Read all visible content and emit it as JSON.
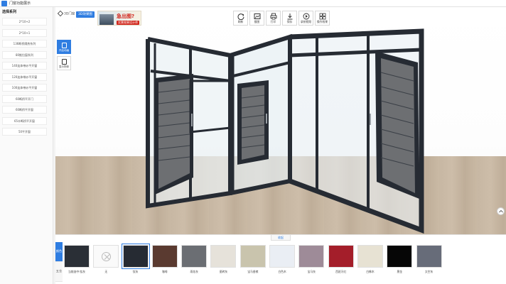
{
  "window": {
    "title": "门窗功能展示"
  },
  "sidebar": {
    "header": "选择系列",
    "items": [
      {
        "label": "2*10+2"
      },
      {
        "label": "2*10+1"
      },
      {
        "label": "136断桥隔热系列"
      },
      {
        "label": "80推拉窗系列"
      },
      {
        "label": "140连体带纱平开窗"
      },
      {
        "label": "120连体带纱平开窗"
      },
      {
        "label": "100连体带纱平开窗"
      },
      {
        "label": "60断桥平开门"
      },
      {
        "label": "60断桥平开窗"
      },
      {
        "label": "65丰断桥平开窗"
      },
      {
        "label": "50平开窗"
      }
    ]
  },
  "viewport": {
    "logo_text": "3D门窗",
    "tag_label": "3D效果图",
    "banner": {
      "title": "急出图?",
      "subtitle": "实景效果设计师"
    },
    "toolbar": [
      {
        "label": "刷新",
        "icon": "refresh-icon"
      },
      {
        "label": "截图",
        "icon": "image-icon"
      },
      {
        "label": "打印",
        "icon": "printer-icon"
      },
      {
        "label": "保存",
        "icon": "download-icon"
      },
      {
        "label": "录制视频",
        "icon": "play-icon"
      },
      {
        "label": "操作效果",
        "icon": "grid-icon"
      }
    ],
    "side_tools": [
      {
        "label": "开启动画",
        "icon": "window-open-icon"
      },
      {
        "label": "显示物体",
        "icon": "cube-icon"
      }
    ]
  },
  "bottom_panel": {
    "handle_label": "收起",
    "tabs": [
      {
        "label": "颜色"
      },
      {
        "label": "五金"
      }
    ],
    "selected_swatch": 2,
    "swatches": [
      {
        "label": "当前选中:钛灰",
        "color": "#2a2f36"
      },
      {
        "label": "无",
        "color": "none"
      },
      {
        "label": "钛灰",
        "color": "#262b33"
      },
      {
        "label": "咖啡",
        "color": "#5a3a30"
      },
      {
        "label": "雨花灰",
        "color": "#6b6e73"
      },
      {
        "label": "瓷砖灰",
        "color": "#e6e2da"
      },
      {
        "label": "宝马香槟",
        "color": "#c9c4ad"
      },
      {
        "label": "白色木",
        "color": "#eaeef4"
      },
      {
        "label": "宝马灰",
        "color": "#9e8b98"
      },
      {
        "label": "西班牙红",
        "color": "#a41e2a"
      },
      {
        "label": "白橡木",
        "color": "#e7e2d3"
      },
      {
        "label": "黑金",
        "color": "#060606"
      },
      {
        "label": "太空灰",
        "color": "#676c79"
      }
    ]
  }
}
